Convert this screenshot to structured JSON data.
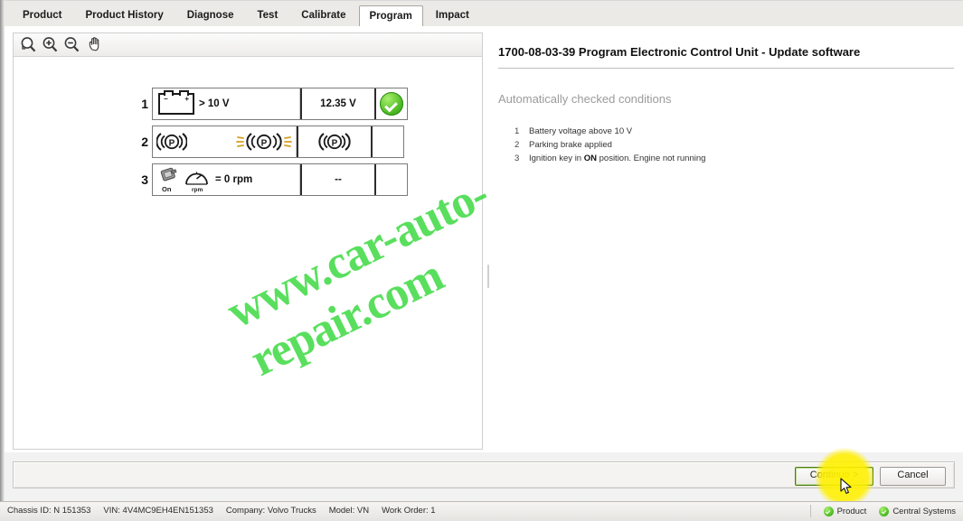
{
  "tabs": [
    {
      "label": "Product",
      "active": false
    },
    {
      "label": "Product History",
      "active": false
    },
    {
      "label": "Diagnose",
      "active": false
    },
    {
      "label": "Test",
      "active": false
    },
    {
      "label": "Calibrate",
      "active": false
    },
    {
      "label": "Program",
      "active": true
    },
    {
      "label": "Impact",
      "active": false
    }
  ],
  "toolbar": {
    "zoom_fit": "zoom-fit-icon",
    "zoom_in": "zoom-in-icon",
    "zoom_out": "zoom-out-icon",
    "pan": "pan-hand-icon"
  },
  "conditions": [
    {
      "number": "1",
      "icon": "battery-icon",
      "description": "> 10 V",
      "value": "12.35 V",
      "status": "ok"
    },
    {
      "number": "2",
      "icon": "parking-brake-icon",
      "description": "",
      "value": "(P)",
      "status": ""
    },
    {
      "number": "3",
      "icon": "ignition-key-icon",
      "icon_label": "On",
      "gauge_label": "rpm",
      "description": "= 0 rpm",
      "value": "--",
      "status": ""
    }
  ],
  "right_panel": {
    "title": "1700-08-03-39 Program Electronic Control Unit - Update software",
    "subtitle": "Automatically checked conditions",
    "items": [
      {
        "index": "1",
        "text_before": "Battery voltage above 10 V",
        "bold": "",
        "text_after": ""
      },
      {
        "index": "2",
        "text_before": "Parking brake applied",
        "bold": "",
        "text_after": ""
      },
      {
        "index": "3",
        "text_before": "Ignition key in ",
        "bold": "ON",
        "text_after": " position. Engine not running"
      }
    ]
  },
  "buttons": {
    "continue": "Continue >",
    "cancel": "Cancel"
  },
  "statusbar": {
    "chassis_label": "Chassis ID:",
    "chassis_value": "N 151353",
    "vin_label": "VIN:",
    "vin_value": "4V4MC9EH4EN151353",
    "company_label": "Company:",
    "company_value": "Volvo Trucks",
    "model_label": "Model:",
    "model_value": "VN",
    "work_order_label": "Work Order:",
    "work_order_value": "1",
    "indicators": [
      {
        "label": "Product",
        "color": "#4caf27"
      },
      {
        "label": "Central Systems",
        "color": "#4caf27"
      }
    ]
  },
  "watermark": {
    "line1": "www.car-auto-repair.com",
    "color": "#35d93a"
  }
}
